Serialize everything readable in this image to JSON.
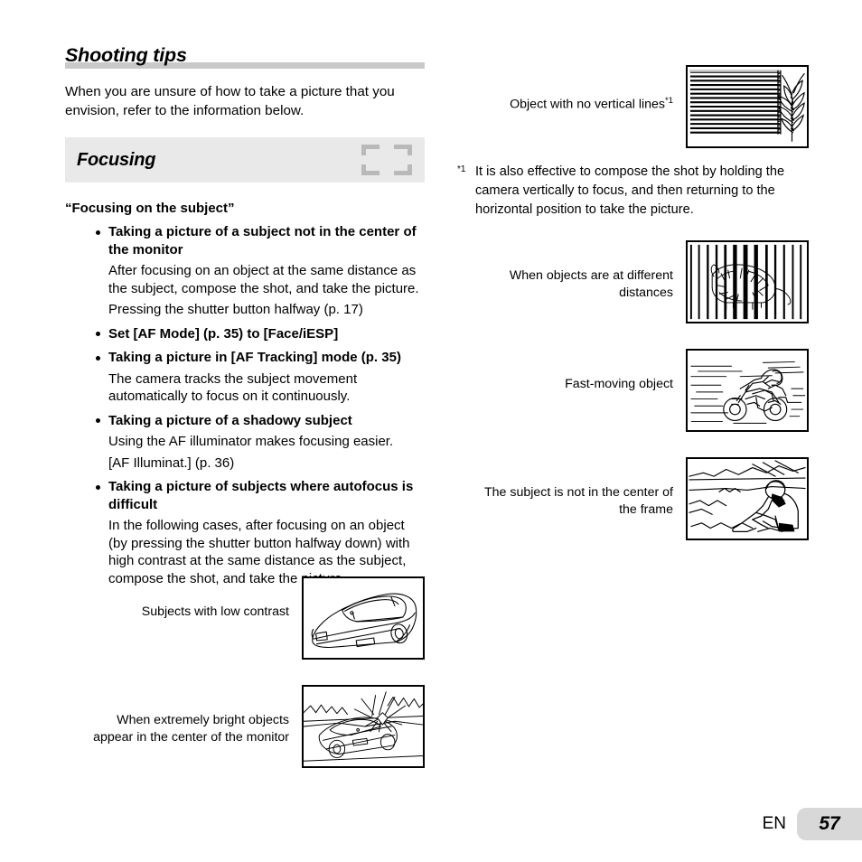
{
  "chapter": {
    "title": "Shooting tips",
    "intro": "When you are unsure of how to take a picture that you envision, refer to the information below."
  },
  "section": {
    "title": "Focusing",
    "icon": "focus-frame-icon"
  },
  "subject_heading": "“Focusing on the subject”",
  "bullets": [
    {
      "heading": "Taking a picture of a subject not in the center of the monitor",
      "paragraphs": [
        "After focusing on an object at the same distance as the subject, compose the shot, and take the picture.",
        "Pressing the shutter button halfway (p. 17)"
      ]
    },
    {
      "heading": "Set [AF Mode] (p. 35) to [Face/iESP]",
      "paragraphs": []
    },
    {
      "heading": "Taking a picture in [AF Tracking] mode (p. 35)",
      "paragraphs": [
        "The camera tracks the subject movement automatically to focus on it continuously."
      ]
    },
    {
      "heading": "Taking a picture of a shadowy subject",
      "paragraphs": [
        "Using the AF illuminator makes focusing easier.",
        "[AF Illuminat.] (p. 36)"
      ]
    },
    {
      "heading": "Taking a picture of subjects where autofocus is difficult",
      "paragraphs": [
        "In the following cases, after focusing on an object (by pressing the shutter button halfway down) with high contrast at the same distance as the subject, compose the shot, and take the picture."
      ]
    }
  ],
  "figures": {
    "low_contrast": {
      "caption": "Subjects with low contrast",
      "illustration": "sports-car-line-art"
    },
    "bright_objects": {
      "caption": "When extremely bright objects\nappear in the center of the monitor",
      "illustration": "car-with-glare-line-art"
    },
    "no_vertical_lines": {
      "caption": "Object with no vertical lines",
      "caption_footnote_marker": "*1",
      "illustration": "horizontal-blinds-with-plant"
    },
    "different_distances": {
      "caption": "When objects are at different\ndistances",
      "illustration": "tiger-behind-bars"
    },
    "fast_moving": {
      "caption": "Fast-moving object",
      "illustration": "motorcycle-with-speed-lines"
    },
    "off_center": {
      "caption": "The subject is not in the center of\nthe frame",
      "illustration": "person-on-beach-off-center"
    }
  },
  "footnote": {
    "marker": "*1",
    "text": "It is also effective to compose the shot by holding the camera vertically to focus, and then returning to the horizontal position to take the picture."
  },
  "footer": {
    "language": "EN",
    "page_number": "57"
  },
  "colors": {
    "heading_rule": "#c9c9c9",
    "section_band": "#e9e9e9",
    "focus_icon": "#b9b9b9",
    "page_badge": "#d8d8d8"
  }
}
